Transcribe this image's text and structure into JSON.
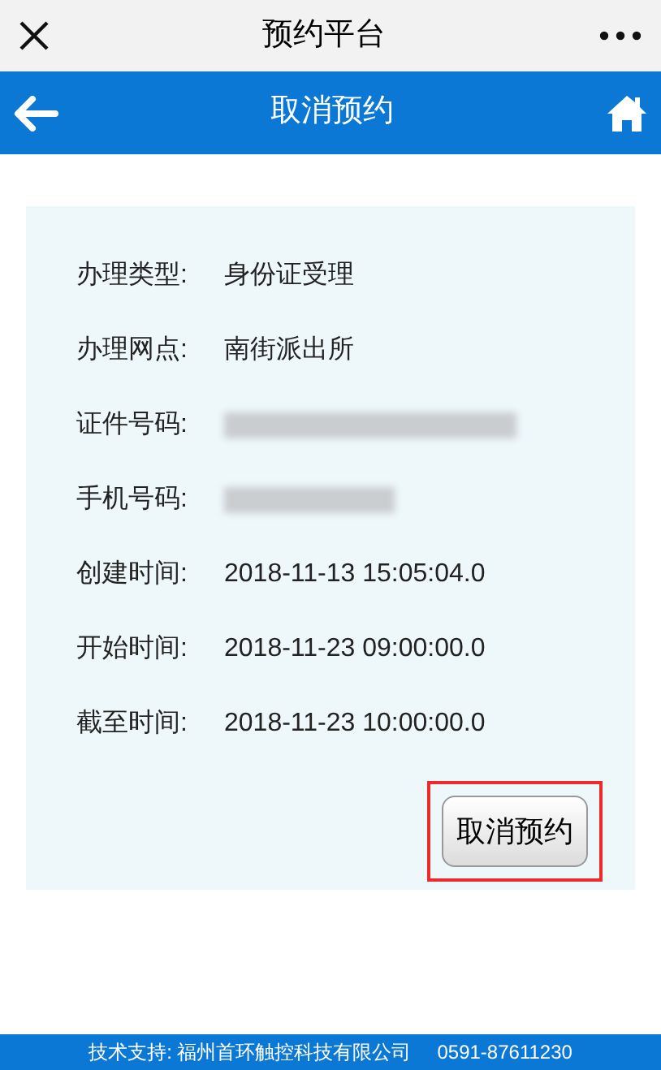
{
  "window": {
    "title": "预约平台"
  },
  "header": {
    "title": "取消预约"
  },
  "details": [
    {
      "kind": "text",
      "label": "办理类型:",
      "value": "身份证受理"
    },
    {
      "kind": "text",
      "label": "办理网点:",
      "value": "南街派出所"
    },
    {
      "kind": "redacted_long",
      "label": "证件号码:"
    },
    {
      "kind": "redacted_short",
      "label": "手机号码:"
    },
    {
      "kind": "text",
      "label": "创建时间:",
      "value": "2018-11-13 15:05:04.0"
    },
    {
      "kind": "text",
      "label": "开始时间:",
      "value": "2018-11-23 09:00:00.0"
    },
    {
      "kind": "text",
      "label": "截至时间:",
      "value": "2018-11-23 10:00:00.0"
    }
  ],
  "cancel_button": {
    "label": "取消预约",
    "highlighted": true
  },
  "footer": {
    "text": "技术支持: 福州首环触控科技有限公司",
    "phone": "0591-87611230"
  }
}
